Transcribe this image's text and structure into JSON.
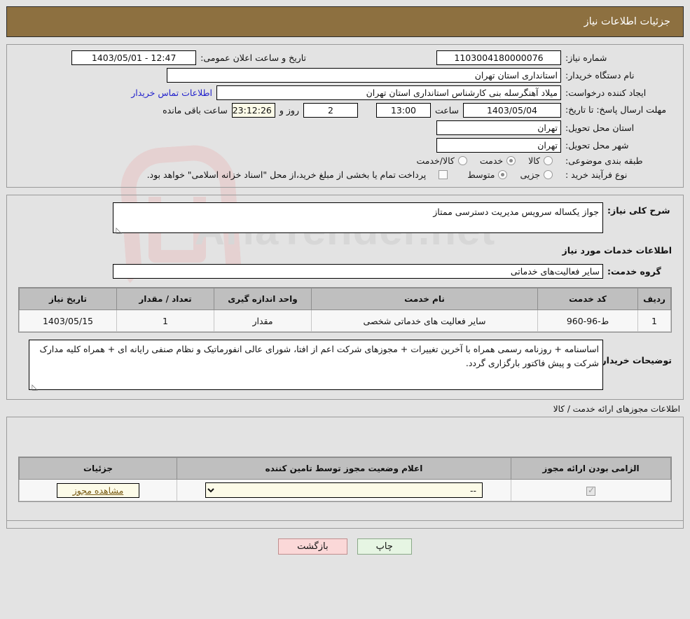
{
  "header": {
    "title": "جزئیات اطلاعات نیاز"
  },
  "summary": {
    "need_number_label": "شماره نیاز:",
    "need_number_value": "1103004180000076",
    "announce_datetime_label": "تاریخ و ساعت اعلان عمومی:",
    "announce_datetime_value": "12:47 - 1403/05/01",
    "buyer_org_label": "نام دستگاه خریدار:",
    "buyer_org_value": "استانداری استان تهران",
    "requester_label": "ایجاد کننده درخواست:",
    "requester_value": "میلاد آهنگرسله بنی کارشناس استانداری استان تهران",
    "buyer_contact_link": "اطلاعات تماس خریدار",
    "deadline_label": "مهلت ارسال پاسخ: تا تاریخ:",
    "deadline_date": "1403/05/04",
    "deadline_hour_label": "ساعت",
    "deadline_hour": "13:00",
    "remaining_days": "2",
    "remaining_days_label": "روز و",
    "remaining_time": "23:12:26",
    "remaining_time_label": "ساعت باقی مانده",
    "province_label": "استان محل تحویل:",
    "province_value": "تهران",
    "city_label": "شهر محل تحویل:",
    "city_value": "تهران",
    "category_label": "طبقه بندی موضوعی:",
    "category_options": [
      {
        "label": "کالا",
        "selected": false
      },
      {
        "label": "خدمت",
        "selected": true
      },
      {
        "label": "کالا/خدمت",
        "selected": false
      }
    ],
    "process_label": "نوع فرآیند خرید :",
    "process_options": [
      {
        "label": "جزیی",
        "selected": false
      },
      {
        "label": "متوسط",
        "selected": true
      }
    ],
    "treasury_checkbox_checked": false,
    "treasury_note": "پرداخت تمام یا بخشی از مبلغ خرید،از محل \"اسناد خزانه اسلامی\" خواهد بود."
  },
  "details": {
    "general_desc_label": "شرح کلی نیاز:",
    "general_desc_value": "جواز یکساله سرویس مدیریت دسترسی ممتاز",
    "services_section_title": "اطلاعات خدمات مورد نیاز",
    "service_group_label": "گروه خدمت:",
    "service_group_value": "سایر فعالیت‌های خدماتی",
    "table": {
      "headers": [
        "ردیف",
        "کد خدمت",
        "نام خدمت",
        "واحد اندازه گیری",
        "تعداد / مقدار",
        "تاریخ نیاز"
      ],
      "rows": [
        {
          "row": "1",
          "service_code": "ط-96-960",
          "service_name": "سایر فعالیت های خدماتی شخصی",
          "unit": "مقدار",
          "quantity": "1",
          "need_date": "1403/05/15"
        }
      ]
    },
    "buyer_notes_label": "توضیحات خریدار:",
    "buyer_notes_value": "اساسنامه + روزنامه رسمی همراه با آخرین تغییرات + مجوزهای شرکت اعم از افتا، شورای عالی انفورماتیک و نظام صنفی رایانه ای + همراه کلیه مدارک شرکت و پیش فاکتور بارگزاری گردد."
  },
  "permits": {
    "section_title": "اطلاعات مجوزهای ارائه خدمت / کالا",
    "headers": [
      "الزامی بودن ارائه مجوز",
      "اعلام وضعیت مجوز توسط تامین کننده",
      "جزئیات"
    ],
    "rows": [
      {
        "required_checked": true,
        "status_value": "--",
        "details_button": "مشاهده مجوز"
      }
    ]
  },
  "footer": {
    "print_label": "چاپ",
    "back_label": "بازگشت"
  },
  "watermark": {
    "text": "AriaTender.net"
  },
  "colors": {
    "header_bg": "#8d7040",
    "link": "#2222cc",
    "print_btn": "#e6f5e3",
    "back_btn": "#fbd8d8",
    "cream_field": "#fcfbe8",
    "table_header": "#bfbfbf"
  }
}
